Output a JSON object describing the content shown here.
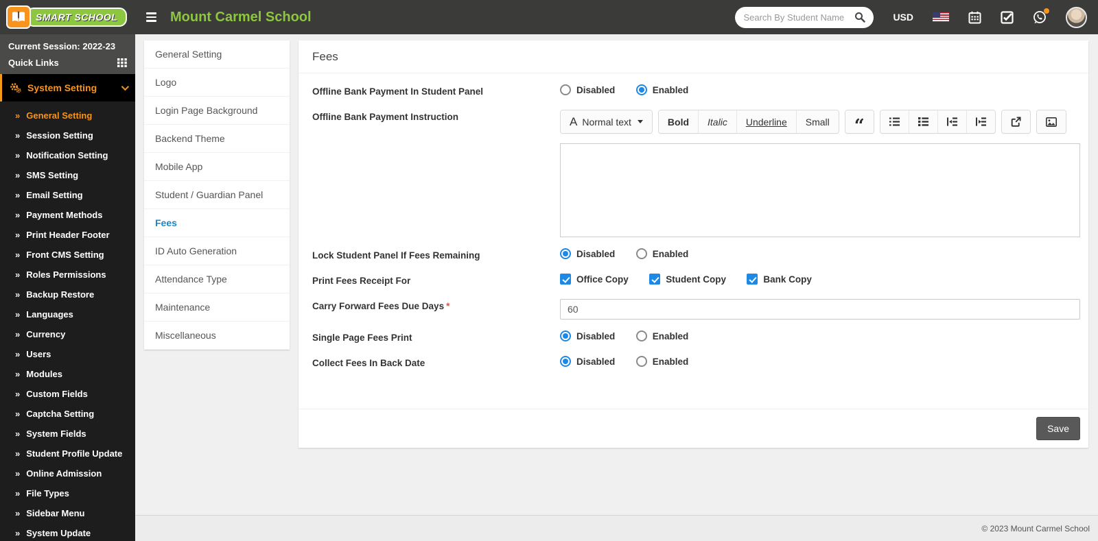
{
  "header": {
    "brand": "SMART SCHOOL",
    "school_name": "Mount Carmel School",
    "search_placeholder": "Search By Student Name",
    "currency": "USD"
  },
  "sidebar": {
    "session": "Current Session: 2022-23",
    "quick_links": "Quick Links",
    "menu_label": "System Setting",
    "items": [
      {
        "label": "General Setting",
        "active": true
      },
      {
        "label": "Session Setting",
        "active": false
      },
      {
        "label": "Notification Setting",
        "active": false
      },
      {
        "label": "SMS Setting",
        "active": false
      },
      {
        "label": "Email Setting",
        "active": false
      },
      {
        "label": "Payment Methods",
        "active": false
      },
      {
        "label": "Print Header Footer",
        "active": false
      },
      {
        "label": "Front CMS Setting",
        "active": false
      },
      {
        "label": "Roles Permissions",
        "active": false
      },
      {
        "label": "Backup Restore",
        "active": false
      },
      {
        "label": "Languages",
        "active": false
      },
      {
        "label": "Currency",
        "active": false
      },
      {
        "label": "Users",
        "active": false
      },
      {
        "label": "Modules",
        "active": false
      },
      {
        "label": "Custom Fields",
        "active": false
      },
      {
        "label": "Captcha Setting",
        "active": false
      },
      {
        "label": "System Fields",
        "active": false
      },
      {
        "label": "Student Profile Update",
        "active": false
      },
      {
        "label": "Online Admission",
        "active": false
      },
      {
        "label": "File Types",
        "active": false
      },
      {
        "label": "Sidebar Menu",
        "active": false
      },
      {
        "label": "System Update",
        "active": false
      }
    ]
  },
  "settings_menu": {
    "items": [
      {
        "label": "General Setting",
        "active": false
      },
      {
        "label": "Logo",
        "active": false
      },
      {
        "label": "Login Page Background",
        "active": false
      },
      {
        "label": "Backend Theme",
        "active": false
      },
      {
        "label": "Mobile App",
        "active": false
      },
      {
        "label": "Student / Guardian Panel",
        "active": false
      },
      {
        "label": "Fees",
        "active": true
      },
      {
        "label": "ID Auto Generation",
        "active": false
      },
      {
        "label": "Attendance Type",
        "active": false
      },
      {
        "label": "Maintenance",
        "active": false
      },
      {
        "label": "Miscellaneous",
        "active": false
      }
    ]
  },
  "main": {
    "title": "Fees",
    "rows": [
      {
        "label": "Offline Bank Payment In Student Panel",
        "type": "radio",
        "options": [
          {
            "label": "Disabled",
            "checked": false
          },
          {
            "label": "Enabled",
            "checked": true
          }
        ]
      },
      {
        "label": "Offline Bank Payment Instruction",
        "type": "editor",
        "editor": {
          "style_label": "Normal text",
          "format_buttons": [
            "Bold",
            "Italic",
            "Underline",
            "Small"
          ],
          "icon_buttons": [
            "quote-icon",
            "ordered-list-icon",
            "unordered-list-icon",
            "outdent-icon",
            "indent-icon",
            "share-icon",
            "picture-icon"
          ],
          "content": ""
        }
      },
      {
        "label": "Lock Student Panel If Fees Remaining",
        "type": "radio",
        "options": [
          {
            "label": "Disabled",
            "checked": true
          },
          {
            "label": "Enabled",
            "checked": false
          }
        ]
      },
      {
        "label": "Print Fees Receipt For",
        "type": "checkbox",
        "options": [
          {
            "label": "Office Copy",
            "checked": true
          },
          {
            "label": "Student Copy",
            "checked": true
          },
          {
            "label": "Bank Copy",
            "checked": true
          }
        ]
      },
      {
        "label": "Carry Forward Fees Due Days",
        "required": true,
        "type": "text",
        "value": "60"
      },
      {
        "label": "Single Page Fees Print",
        "type": "radio",
        "options": [
          {
            "label": "Disabled",
            "checked": true
          },
          {
            "label": "Enabled",
            "checked": false
          }
        ]
      },
      {
        "label": "Collect Fees In Back Date",
        "type": "radio",
        "options": [
          {
            "label": "Disabled",
            "checked": true
          },
          {
            "label": "Enabled",
            "checked": false
          }
        ]
      }
    ],
    "save_label": "Save"
  },
  "footer": {
    "copyright": "© 2023 Mount Carmel School"
  },
  "colors": {
    "header_bg": "#3b3b39",
    "sidebar_bg": "#1d1d1d",
    "accent_orange": "#f7941e",
    "brand_green": "#8dc63f",
    "control_blue": "#1e88e5",
    "active_link_blue": "#1a87c8",
    "save_gray": "#595959",
    "required_red": "#e74c3c"
  }
}
